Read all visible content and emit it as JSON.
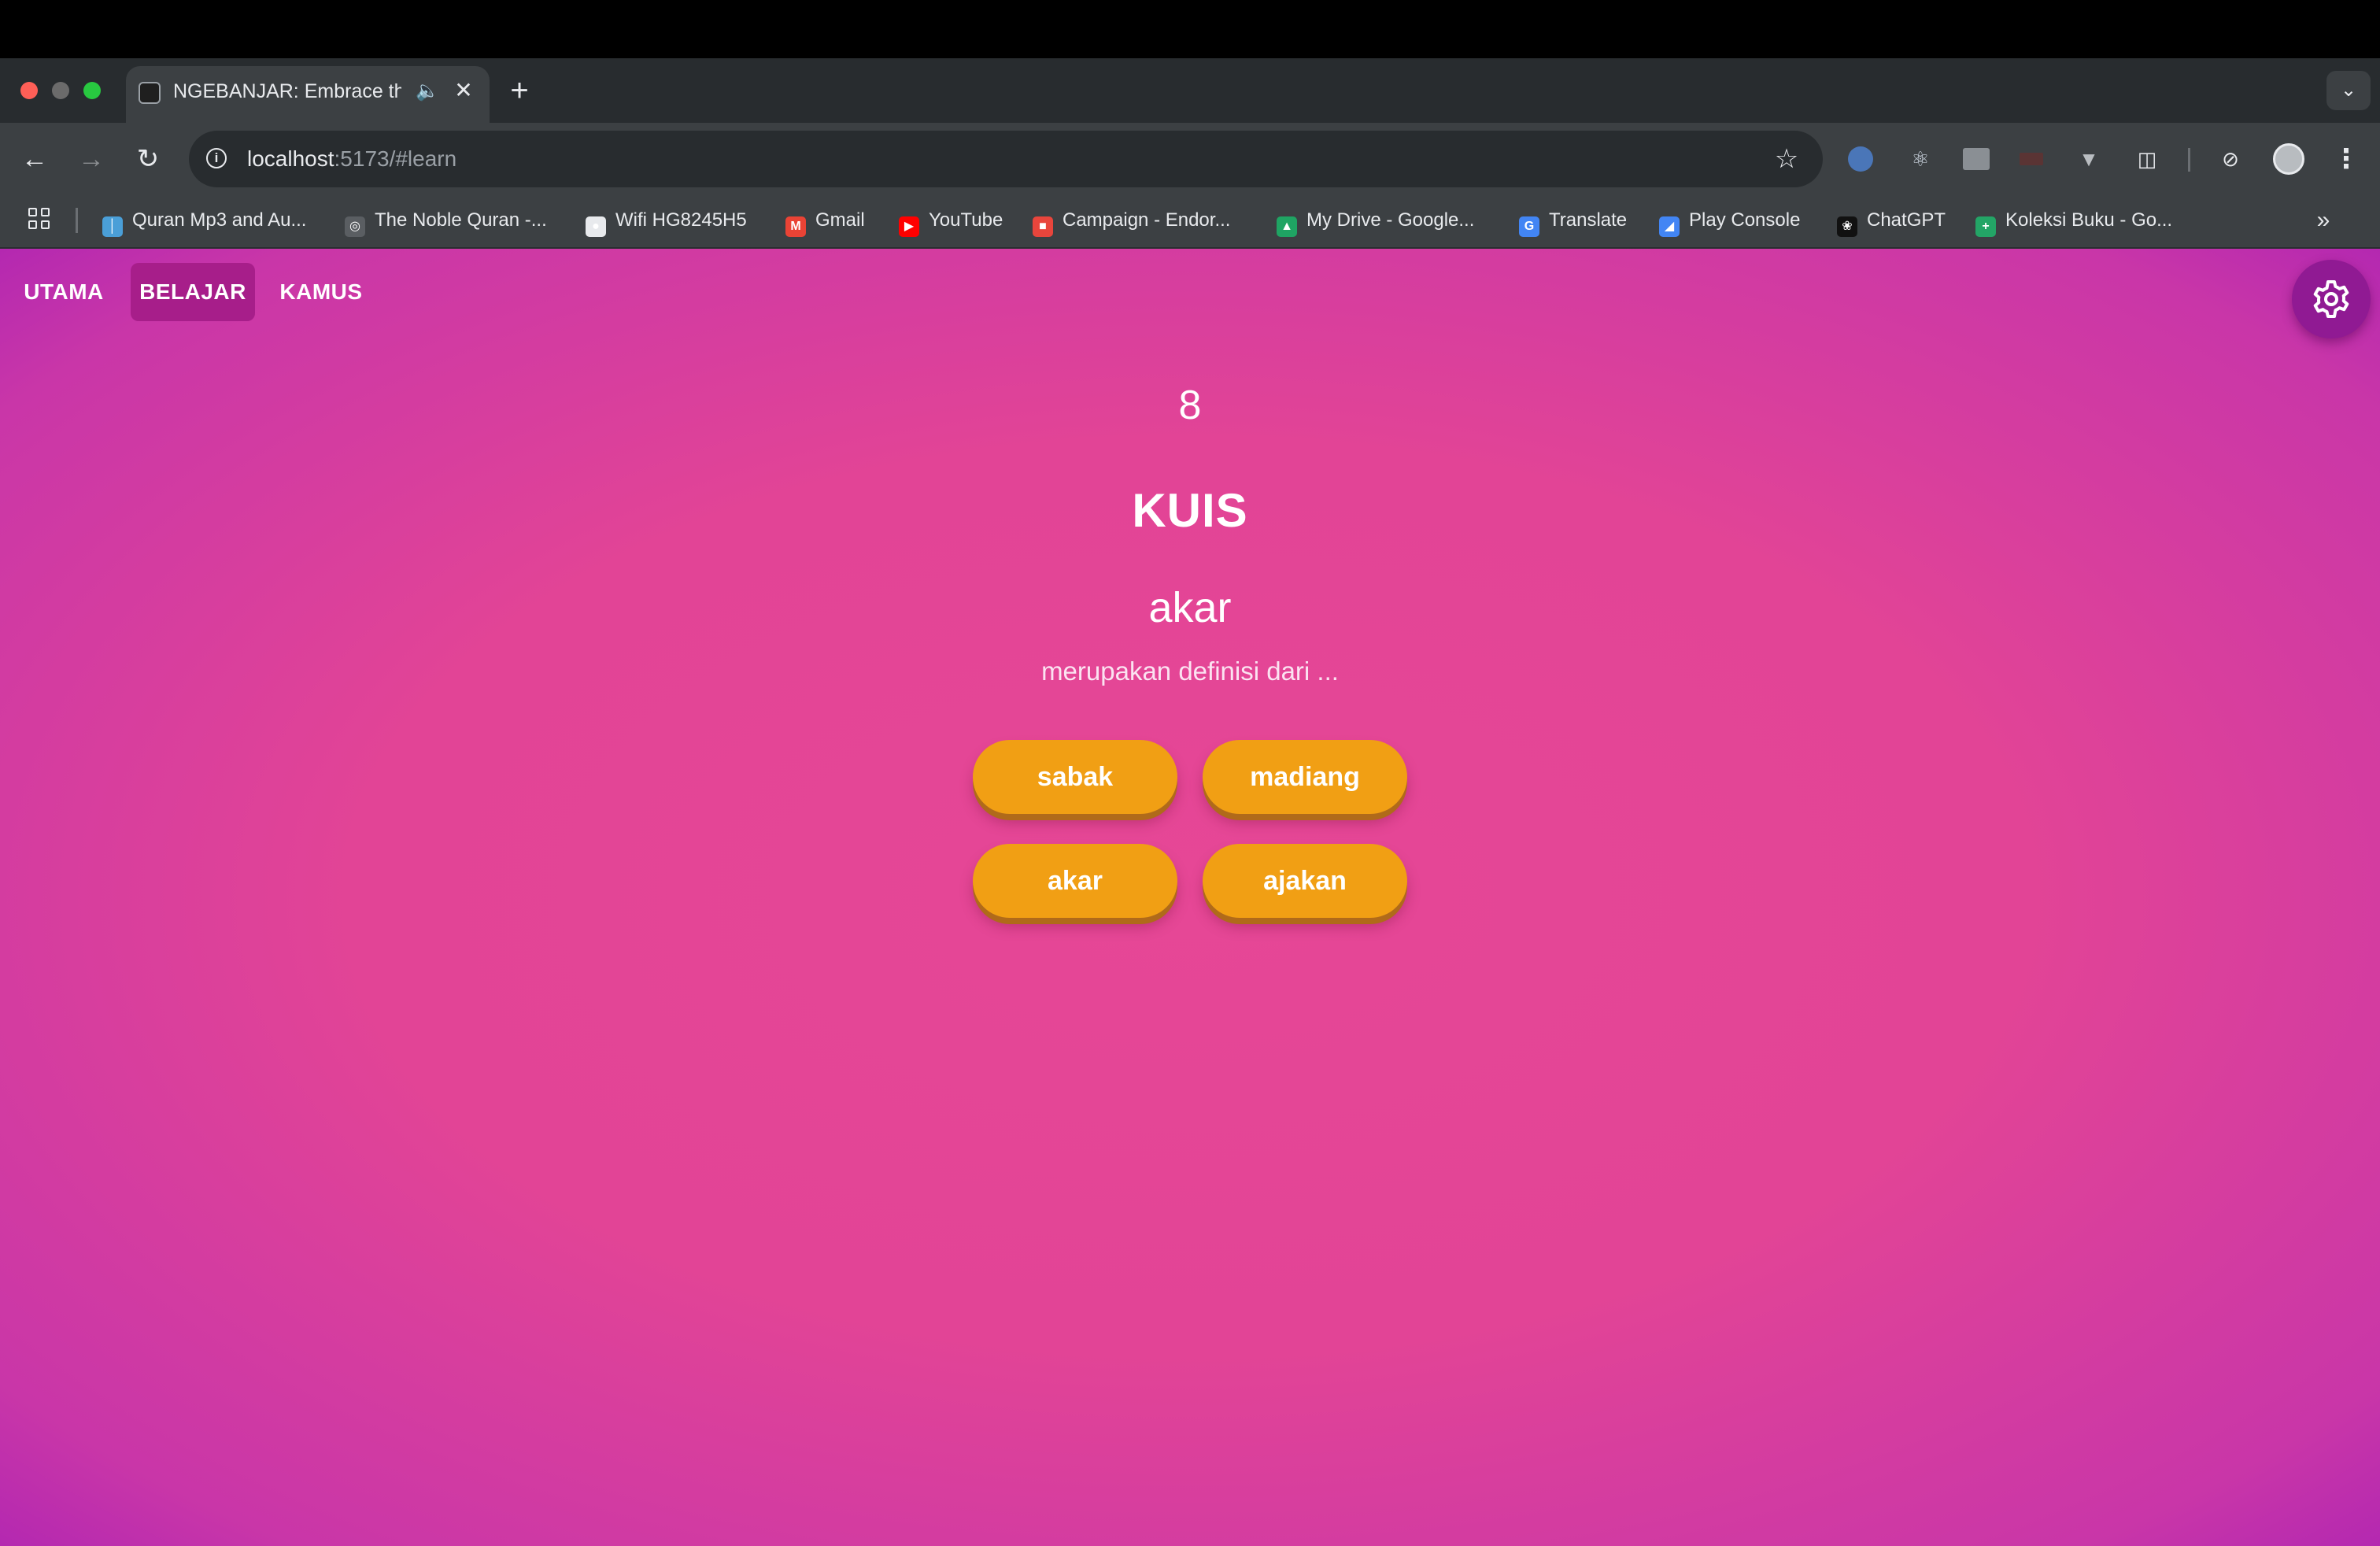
{
  "browser": {
    "tab_title": "NGEBANJAR: Embrace the",
    "url_host": "localhost",
    "url_rest": ":5173/#learn",
    "icons": {
      "back": "back-arrow-icon",
      "forward": "forward-arrow-icon",
      "reload": "reload-icon",
      "info": "info-icon",
      "bookmark": "star-icon",
      "menu": "vertical-dots-icon",
      "apps": "apps-grid-icon",
      "more_bookmarks": "double-chevron-icon"
    }
  },
  "bookmarks": [
    {
      "label": "Quran Mp3 and Au...",
      "icon": "microphone-icon",
      "color": "#4a9fd8"
    },
    {
      "label": "The Noble Quran -...",
      "icon": "quran-icon",
      "color": "#5a5e62"
    },
    {
      "label": "Wifi HG8245H5",
      "icon": "globe-icon",
      "color": "#e8eaed"
    },
    {
      "label": "Gmail",
      "icon": "gmail-icon",
      "color": "#ea4335"
    },
    {
      "label": "YouTube",
      "icon": "youtube-icon",
      "color": "#ff0000"
    },
    {
      "label": "Campaign - Endor...",
      "icon": "campaign-icon",
      "color": "#e8453c"
    },
    {
      "label": "My Drive - Google...",
      "icon": "google-drive-icon",
      "color": "#1fa463"
    },
    {
      "label": "Translate",
      "icon": "google-translate-icon",
      "color": "#4285f4"
    },
    {
      "label": "Play Console",
      "icon": "play-console-icon",
      "color": "#4285f4"
    },
    {
      "label": "ChatGPT",
      "icon": "chatgpt-icon",
      "color": "#111111"
    },
    {
      "label": "Koleksi Buku - Go...",
      "icon": "google-sheets-icon",
      "color": "#23a566"
    }
  ],
  "nav": {
    "items": [
      "UTAMA",
      "BELAJAR",
      "KAMUS"
    ],
    "active": "BELAJAR",
    "settings_icon": "gear-icon"
  },
  "quiz": {
    "counter": "8",
    "title": "KUIS",
    "word": "akar",
    "prompt": "merupakan definisi dari ...",
    "answers": [
      "sabak",
      "madiang",
      "akar",
      "ajakan"
    ]
  },
  "colors": {
    "gradient_center": "#e64796",
    "gradient_edge": "#a11cb8",
    "answer_button": "#f19f14",
    "active_nav": "#a71e8a",
    "settings_button": "#901a93"
  }
}
